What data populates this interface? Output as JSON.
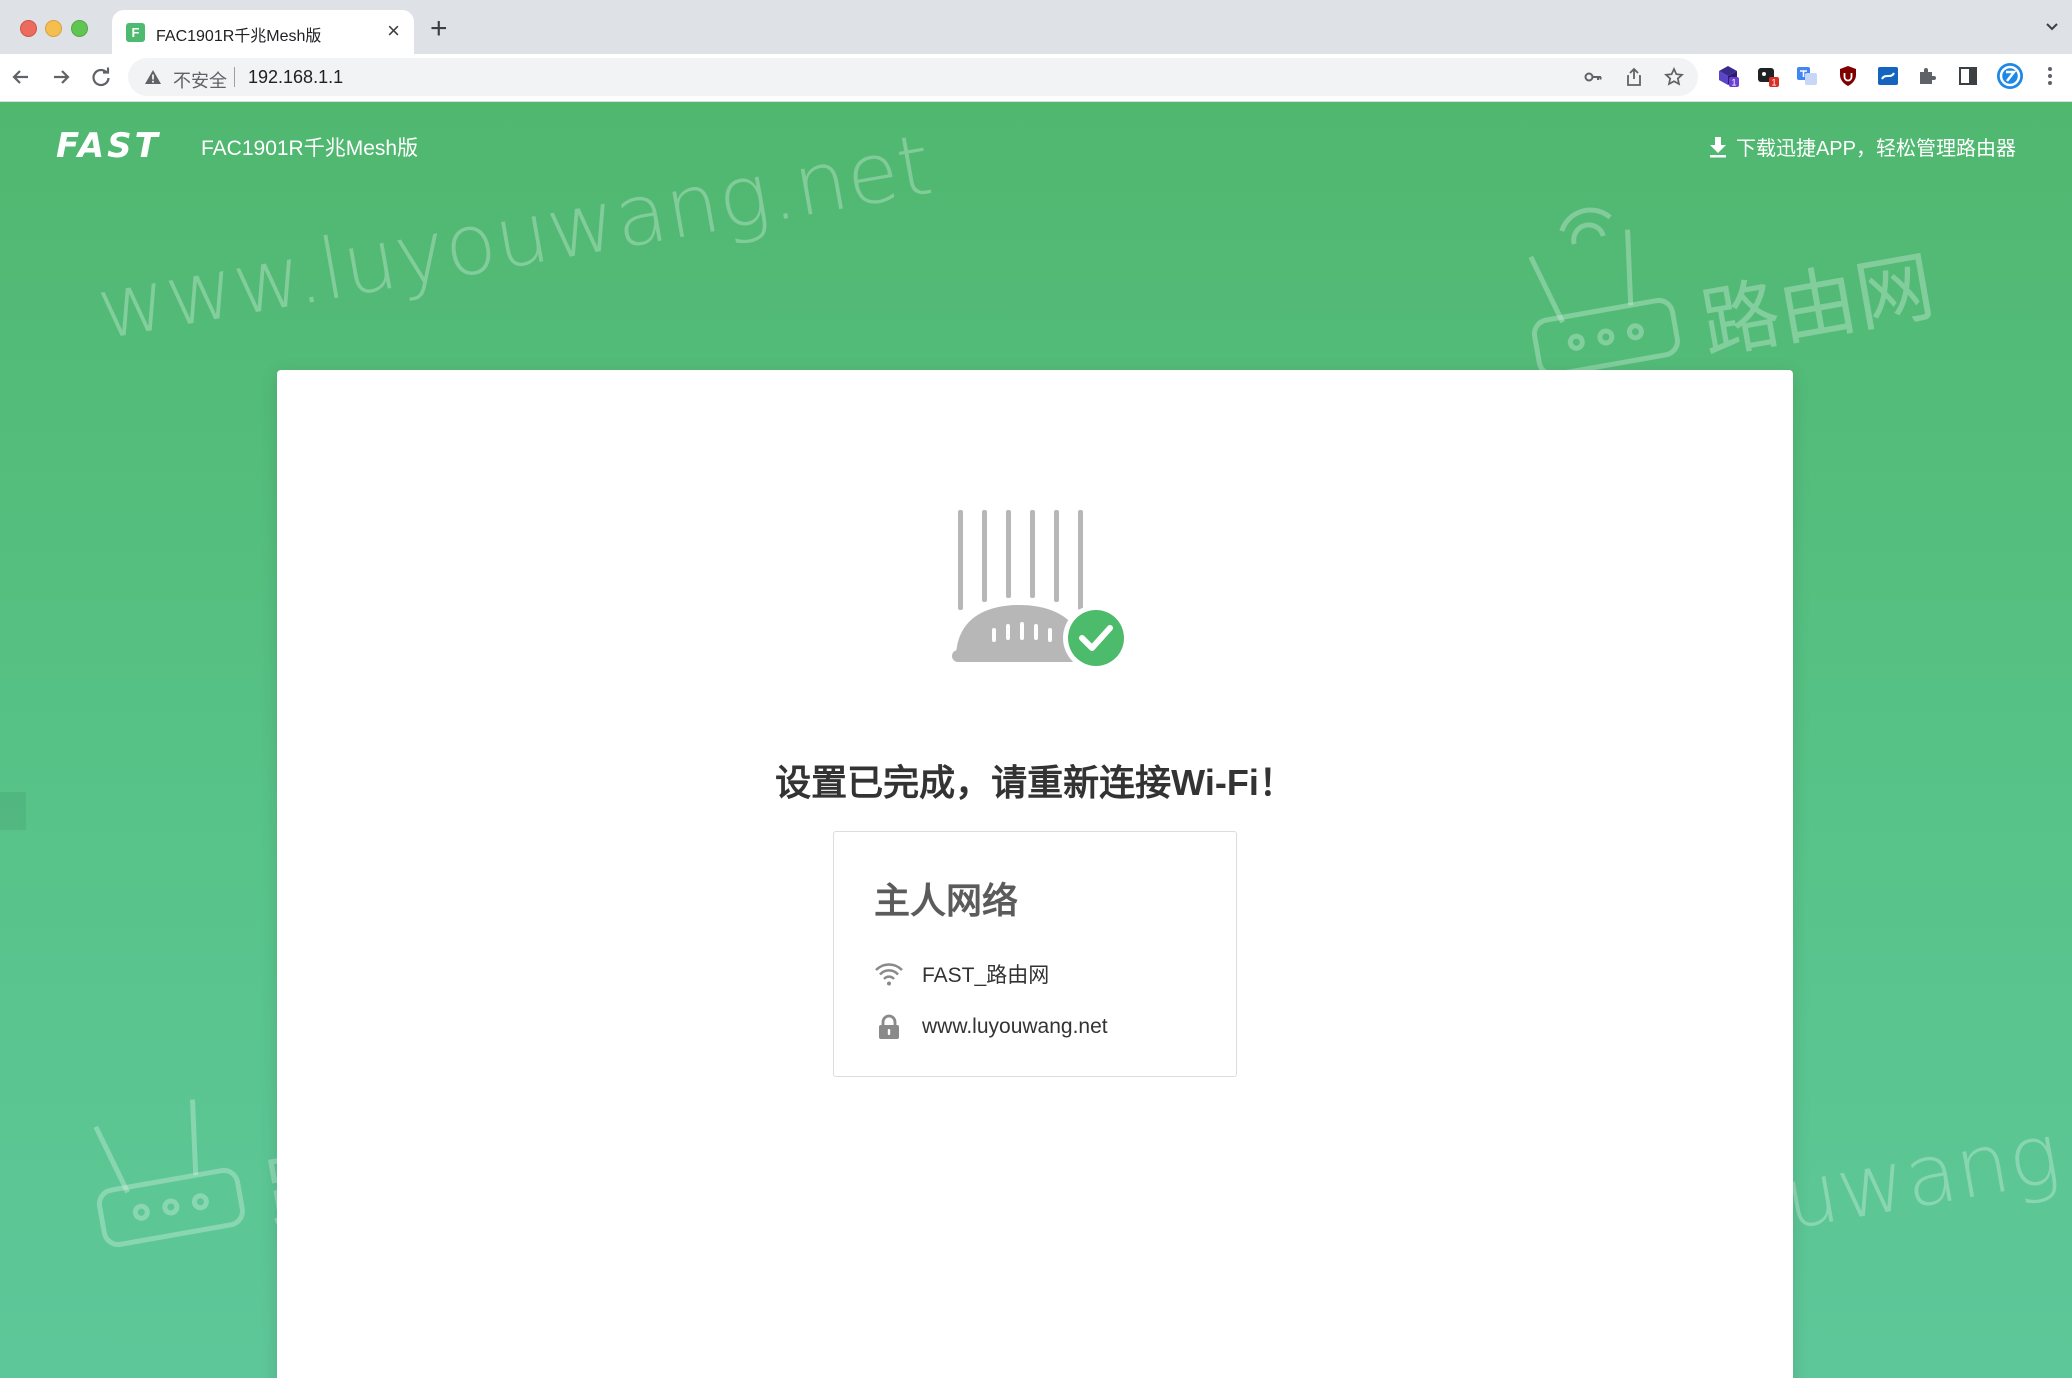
{
  "browser": {
    "tab": {
      "title": "FAC1901R千兆Mesh版",
      "favicon_letter": "F",
      "close_glyph": "×"
    },
    "new_tab_glyph": "+",
    "address_bar": {
      "security_label": "不安全",
      "url": "192.168.1.1"
    },
    "extension_badges": [
      "1",
      "1"
    ]
  },
  "header": {
    "logo_text": "FAST",
    "model": "FAC1901R千兆Mesh版",
    "download_link": "下载迅捷APP，轻松管理路由器"
  },
  "watermarks": {
    "url_text": "www.luyouwang.net",
    "logo_text": "路由网"
  },
  "main": {
    "title": "设置已完成，请重新连接Wi-Fi！",
    "network_card": {
      "heading": "主人网络",
      "ssid": "FAST_路由网",
      "password": "www.luyouwang.net"
    }
  },
  "colors": {
    "brand_green": "#50b76f",
    "check_green": "#4cbb6b",
    "router_gray": "#b7b7b7"
  }
}
